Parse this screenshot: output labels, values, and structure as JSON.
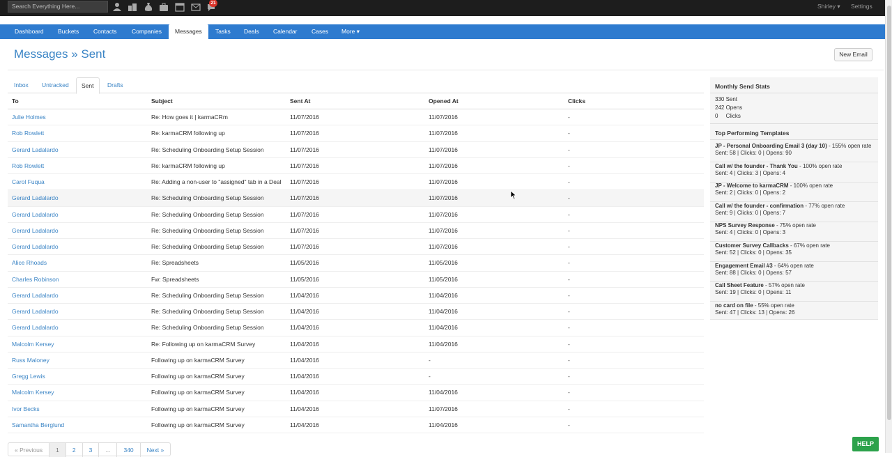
{
  "topbar": {
    "search_placeholder": "Search Everything Here...",
    "icons": [
      "person-icon",
      "buildings-icon",
      "money-bag-icon",
      "briefcase-icon",
      "calendar-icon",
      "envelope-icon",
      "notification-icon"
    ],
    "notification_count": "21",
    "user": "Shirley",
    "settings": "Settings"
  },
  "nav": {
    "items": [
      "Dashboard",
      "Buckets",
      "Contacts",
      "Companies",
      "Messages",
      "Tasks",
      "Deals",
      "Calendar",
      "Cases",
      "More"
    ],
    "active": "Messages"
  },
  "page": {
    "title": "Messages » Sent",
    "new_email": "New Email"
  },
  "tabs": [
    "Inbox",
    "Untracked",
    "Sent",
    "Drafts"
  ],
  "table": {
    "headers": [
      "To",
      "Subject",
      "Sent At",
      "Opened At",
      "Clicks"
    ],
    "rows": [
      {
        "to": "Julie Holmes",
        "subject": "Re: How goes it | karmaCRm",
        "sent": "11/07/2016",
        "opened": "11/07/2016",
        "clicks": "-"
      },
      {
        "to": "Rob Rowlett",
        "subject": "Re: karmaCRM following up",
        "sent": "11/07/2016",
        "opened": "11/07/2016",
        "clicks": "-"
      },
      {
        "to": "Gerard Ladalardo",
        "subject": "Re: Scheduling Onboarding Setup Session",
        "sent": "11/07/2016",
        "opened": "11/07/2016",
        "clicks": "-"
      },
      {
        "to": "Rob Rowlett",
        "subject": "Re: karmaCRM following up",
        "sent": "11/07/2016",
        "opened": "11/07/2016",
        "clicks": "-"
      },
      {
        "to": "Carol Fuqua",
        "subject": "Re: Adding a non-user to \"assigned\" tab in a Deal",
        "sent": "11/07/2016",
        "opened": "11/07/2016",
        "clicks": "-"
      },
      {
        "to": "Gerard Ladalardo",
        "subject": "Re: Scheduling Onboarding Setup Session",
        "sent": "11/07/2016",
        "opened": "11/07/2016",
        "clicks": "-"
      },
      {
        "to": "Gerard Ladalardo",
        "subject": "Re: Scheduling Onboarding Setup Session",
        "sent": "11/07/2016",
        "opened": "11/07/2016",
        "clicks": "-"
      },
      {
        "to": "Gerard Ladalardo",
        "subject": "Re: Scheduling Onboarding Setup Session",
        "sent": "11/07/2016",
        "opened": "11/07/2016",
        "clicks": "-"
      },
      {
        "to": "Gerard Ladalardo",
        "subject": "Re: Scheduling Onboarding Setup Session",
        "sent": "11/07/2016",
        "opened": "11/07/2016",
        "clicks": "-"
      },
      {
        "to": "Alice Rhoads",
        "subject": "Re: Spreadsheets",
        "sent": "11/05/2016",
        "opened": "11/05/2016",
        "clicks": "-"
      },
      {
        "to": "Charles Robinson",
        "subject": "Fw: Spreadsheets",
        "sent": "11/05/2016",
        "opened": "11/05/2016",
        "clicks": "-"
      },
      {
        "to": "Gerard Ladalardo",
        "subject": "Re: Scheduling Onboarding Setup Session",
        "sent": "11/04/2016",
        "opened": "11/04/2016",
        "clicks": "-"
      },
      {
        "to": "Gerard Ladalardo",
        "subject": "Re: Scheduling Onboarding Setup Session",
        "sent": "11/04/2016",
        "opened": "11/04/2016",
        "clicks": "-"
      },
      {
        "to": "Gerard Ladalardo",
        "subject": "Re: Scheduling Onboarding Setup Session",
        "sent": "11/04/2016",
        "opened": "11/04/2016",
        "clicks": "-"
      },
      {
        "to": "Malcolm Kersey",
        "subject": "Re: Following up on karmaCRM Survey",
        "sent": "11/04/2016",
        "opened": "11/04/2016",
        "clicks": "-"
      },
      {
        "to": "Russ Maloney",
        "subject": "Following up on karmaCRM Survey",
        "sent": "11/04/2016",
        "opened": "-",
        "clicks": "-"
      },
      {
        "to": "Gregg Lewis",
        "subject": "Following up on karmaCRM Survey",
        "sent": "11/04/2016",
        "opened": "-",
        "clicks": "-"
      },
      {
        "to": "Malcolm Kersey",
        "subject": "Following up on karmaCRM Survey",
        "sent": "11/04/2016",
        "opened": "11/04/2016",
        "clicks": "-"
      },
      {
        "to": "Ivor Becks",
        "subject": "Following up on karmaCRM Survey",
        "sent": "11/04/2016",
        "opened": "11/07/2016",
        "clicks": "-"
      },
      {
        "to": "Samantha Berglund",
        "subject": "Following up on karmaCRM Survey",
        "sent": "11/04/2016",
        "opened": "11/04/2016",
        "clicks": "-"
      }
    ]
  },
  "pagination": {
    "prev": "« Previous",
    "pages": [
      "1",
      "2",
      "3",
      "...",
      "340"
    ],
    "next": "Next »"
  },
  "sidebar": {
    "stats_title": "Monthly Send Stats",
    "stats": [
      "330 Sent",
      "242 Opens",
      "0     Clicks"
    ],
    "templates_title": "Top Performing Templates",
    "templates": [
      {
        "name": "JP - Personal Onboarding Email 3 (day 10)",
        "rate": " - 155% open rate",
        "meta": "Sent: 58 | Clicks: 0 | Opens: 90"
      },
      {
        "name": "Call w/ the founder - Thank You",
        "rate": " - 100% open rate",
        "meta": "Sent: 4 | Clicks: 3 | Opens: 4"
      },
      {
        "name": "JP - Welcome to karmaCRM",
        "rate": " - 100% open rate",
        "meta": "Sent: 2 | Clicks: 0 | Opens: 2"
      },
      {
        "name": "Call w/ the founder - confirmation",
        "rate": " - 77% open rate",
        "meta": "Sent: 9 | Clicks: 0 | Opens: 7"
      },
      {
        "name": "NPS Survey Response",
        "rate": " - 75% open rate",
        "meta": "Sent: 4 | Clicks: 0 | Opens: 3"
      },
      {
        "name": "Customer Survey Callbacks",
        "rate": " - 67% open rate",
        "meta": "Sent: 52 | Clicks: 0 | Opens: 35"
      },
      {
        "name": "Engagement Email #3",
        "rate": " - 64% open rate",
        "meta": "Sent: 88 | Clicks: 0 | Opens: 57"
      },
      {
        "name": "Call Sheet Feature",
        "rate": " - 57% open rate",
        "meta": "Sent: 19 | Clicks: 0 | Opens: 11"
      },
      {
        "name": "no card on file",
        "rate": " - 55% open rate",
        "meta": "Sent: 47 | Clicks: 13 | Opens: 26"
      }
    ]
  },
  "help": "HELP",
  "colors": {
    "nav": "#2e7bcf",
    "link": "#3a84c5",
    "help": "#2ca24b",
    "badge": "#d9352b"
  }
}
